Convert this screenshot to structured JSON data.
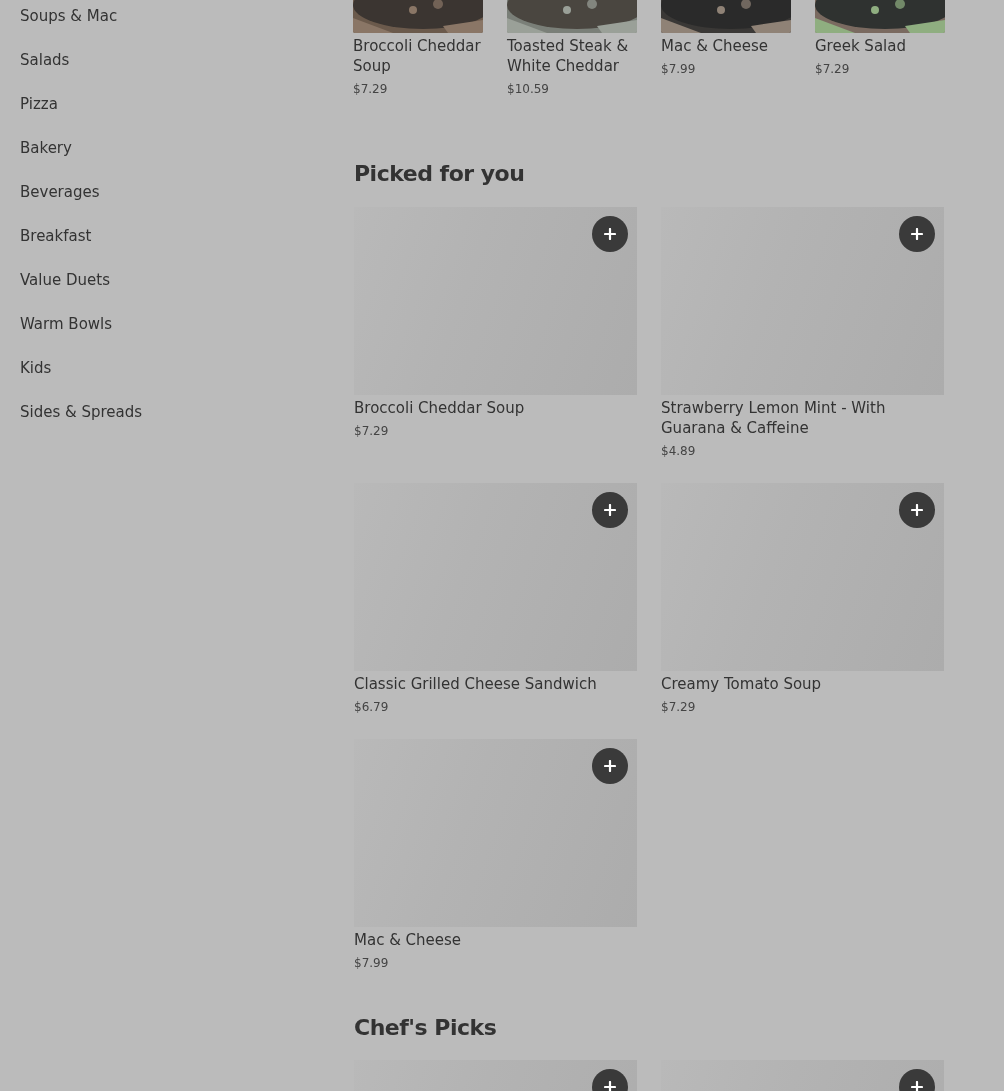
{
  "sidebar": {
    "items": [
      {
        "label": "Soups & Mac"
      },
      {
        "label": "Salads"
      },
      {
        "label": "Pizza"
      },
      {
        "label": "Bakery"
      },
      {
        "label": "Beverages"
      },
      {
        "label": "Breakfast"
      },
      {
        "label": "Value Duets"
      },
      {
        "label": "Warm Bowls"
      },
      {
        "label": "Kids"
      },
      {
        "label": "Sides & Spreads"
      }
    ]
  },
  "top_row": {
    "items": [
      {
        "name": "Broccoli Cheddar Soup",
        "price": "$7.29",
        "kind": "picture"
      },
      {
        "name": "Toasted Steak & White Cheddar",
        "price": "$10.59",
        "kind": "picture"
      },
      {
        "name": "Mac & Cheese",
        "price": "$7.99",
        "kind": "picture"
      },
      {
        "name": "Greek Salad",
        "price": "$7.29",
        "kind": "picture"
      }
    ]
  },
  "sections": [
    {
      "title": "Picked for you",
      "items": [
        {
          "name": "Broccoli Cheddar Soup",
          "price": "$7.29",
          "kind": "placeholder"
        },
        {
          "name": "Strawberry Lemon Mint - With Guarana & Caffeine",
          "price": "$4.89",
          "kind": "placeholder"
        },
        {
          "name": "Classic Grilled Cheese Sandwich",
          "price": "$6.79",
          "kind": "placeholder"
        },
        {
          "name": "Creamy Tomato Soup",
          "price": "$7.29",
          "kind": "placeholder"
        },
        {
          "name": "Mac & Cheese",
          "price": "$7.99",
          "kind": "placeholder"
        }
      ]
    },
    {
      "title": "Chef's Picks",
      "items": [
        {
          "kind": "placeholder"
        },
        {
          "kind": "placeholder"
        }
      ]
    }
  ]
}
